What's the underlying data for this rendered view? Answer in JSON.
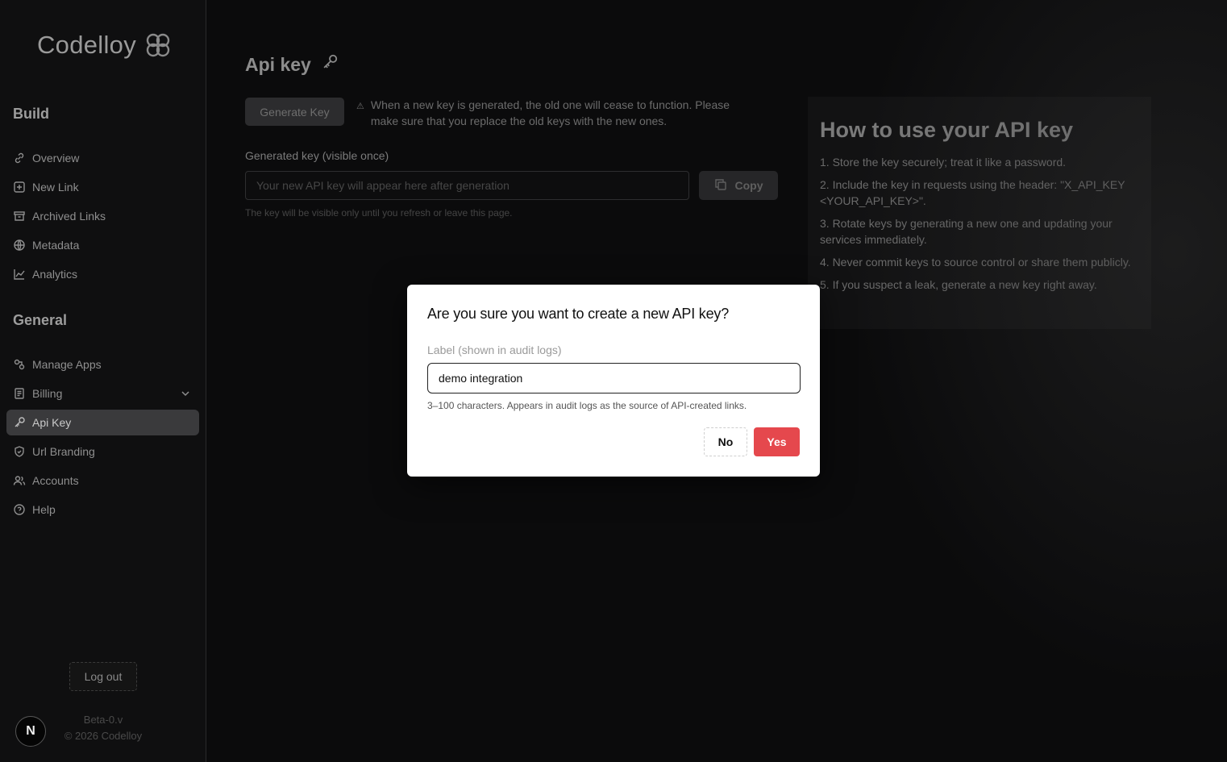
{
  "brand": {
    "name": "Codelloy",
    "logo_icon": "knot-logo-icon"
  },
  "sidebar": {
    "sections": [
      {
        "title": "Build",
        "items": [
          {
            "label": "Overview",
            "icon": "link-icon"
          },
          {
            "label": "New Link",
            "icon": "plus-square-icon"
          },
          {
            "label": "Archived Links",
            "icon": "archive-icon"
          },
          {
            "label": "Metadata",
            "icon": "globe-icon"
          },
          {
            "label": "Analytics",
            "icon": "chart-line-icon"
          }
        ]
      },
      {
        "title": "General",
        "items": [
          {
            "label": "Manage Apps",
            "icon": "apps-icon"
          },
          {
            "label": "Billing",
            "icon": "receipt-icon",
            "expandable": true
          },
          {
            "label": "Api Key",
            "icon": "key-icon",
            "active": true
          },
          {
            "label": "Url Branding",
            "icon": "shield-icon"
          },
          {
            "label": "Accounts",
            "icon": "users-icon"
          },
          {
            "label": "Help",
            "icon": "help-circle-icon"
          }
        ]
      }
    ],
    "logout_label": "Log out",
    "version": "Beta-0.v",
    "copyright": "© 2026 Codelloy",
    "badge_letter": "N"
  },
  "main": {
    "title": "Api key",
    "generate_button": "Generate Key",
    "warning_text": "When a new key is generated, the old one will cease to function. Please make sure that you replace the old keys with the new ones.",
    "generated_label": "Generated key (visible once)",
    "key_placeholder": "Your new API key will appear here after generation",
    "copy_label": "Copy",
    "key_hint": "The key will be visible only until you refresh or leave this page."
  },
  "howto": {
    "title": "How to use your API key",
    "steps": [
      "1. Store the key securely; treat it like a password.",
      "2. Include the key in requests using the header: \"X_API_KEY <YOUR_API_KEY>\".",
      "3. Rotate keys by generating a new one and updating your services immediately.",
      "4. Never commit keys to source control or share them publicly.",
      "5. If you suspect a leak, generate a new key right away."
    ]
  },
  "modal": {
    "title": "Are you sure you want to create a new API key?",
    "field_label": "Label (shown in audit logs)",
    "field_value": "demo integration",
    "field_help": "3–100 characters. Appears in audit logs as the source of API-created links.",
    "no_label": "No",
    "yes_label": "Yes"
  },
  "colors": {
    "accent_danger": "#e5484d",
    "active_nav_bg": "#3a3a3c"
  }
}
